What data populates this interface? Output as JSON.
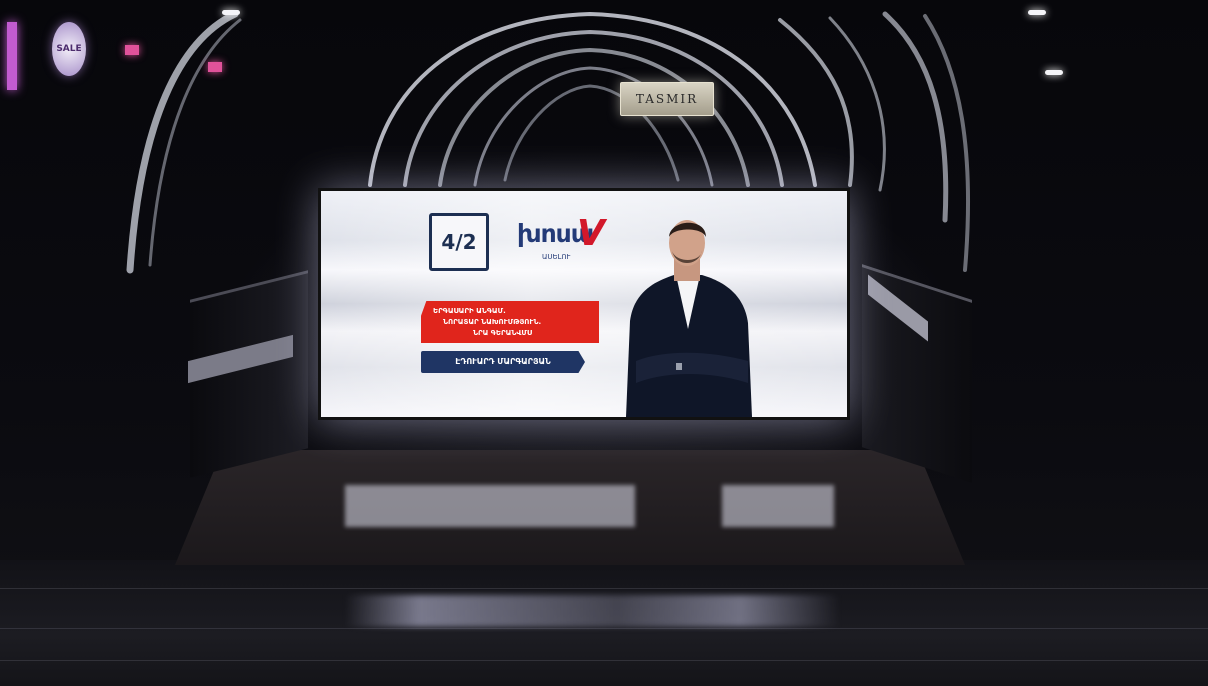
{
  "scene": {
    "store_sign": "TASMIR",
    "sale_badge": "SALE"
  },
  "billboard": {
    "channel_logo": "4/2",
    "show_logo": {
      "main": "խոսա",
      "accent": "V",
      "sub": "ԱՍԵԼՈՒ"
    },
    "red_banner": {
      "line1": "ԵՐԳԱՍԱՐԻ ԱՆԳԱՄ.",
      "line2": "ՆՈՐԱՏԱՐ ՆԱԽՈՒՄԹՅՈՒՆ.",
      "line3": "ՆՐԱ ԳԵՐԱՆՎՄՍ"
    },
    "navy_banner": "ԷԴՈՒԱՐԴ ՄԱՐԳԱՐՅԱՆ"
  },
  "colors": {
    "navy": "#1f3564",
    "red": "#e0251c",
    "screen_white": "#f3f3f7"
  }
}
